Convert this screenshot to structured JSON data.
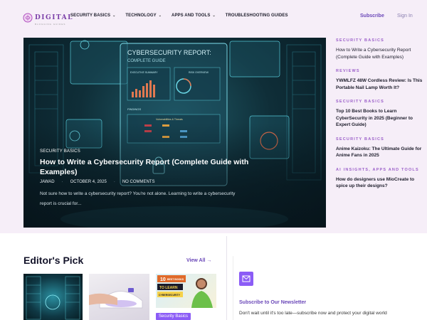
{
  "brand": {
    "name": "DIGITAL",
    "tagline": "BLOGGING GUIDES",
    "accent": "#7b3fa8"
  },
  "nav": {
    "items": [
      {
        "label": "SECURITY BASICS",
        "has_dropdown": true
      },
      {
        "label": "TECHNOLOGY",
        "has_dropdown": true
      },
      {
        "label": "APPS AND TOOLS",
        "has_dropdown": true
      },
      {
        "label": "TROUBLESHOOTING GUIDES",
        "has_dropdown": false
      }
    ],
    "subscribe": "Subscribe",
    "signin": "Sign In"
  },
  "hero": {
    "category": "SECURITY BASICS",
    "title": "How to Write a Cybersecurity Report (Complete Guide with Examples)",
    "author": "JAWAD",
    "date": "OCTOBER 4, 2025",
    "comments": "NO COMMENTS",
    "excerpt": "Not sure how to write a cybersecurity report? You're not alone. Learning to write a cybersecurity report is crucial for...",
    "image_text": {
      "heading": "CYBERSECURITY REPORT:",
      "subheading": "COMPLETE GUIDE",
      "panel_a": "EXECUTIVE SUMMARY",
      "panel_b": "RISK OVERVIEW",
      "panel_c": "FINDINGS",
      "panel_d": "Vulnerabilities & Threats"
    }
  },
  "sidebar": {
    "items": [
      {
        "category": "SECURITY BASICS",
        "title": "How to Write a Cybersecurity Report (Complete Guide with Examples)",
        "bold": false
      },
      {
        "category": "REVIEWS",
        "title": "YWMLFZ 48W Cordless Review: Is This Portable Nail Lamp Worth It?",
        "bold": true
      },
      {
        "category": "SECURITY BASICS",
        "title": "Top 10 Best Books to Learn CyberSecurity in 2025 (Beginner to Expert Guide)",
        "bold": true
      },
      {
        "category": "SECURITY BASICS",
        "title": "Anime Kaizoku: The Ultimate Guide for Anime Fans in 2025",
        "bold": true
      },
      {
        "category": "AI INSIGHTS, APPS AND TOOLS",
        "title": "How do designers use MioCreate to spice up their designs?",
        "bold": true
      }
    ]
  },
  "editors_pick": {
    "heading": "Editor's Pick",
    "view_all": "View All →",
    "badge": "Security Basics",
    "thumb3_text": {
      "num": "10",
      "line1": "BEST BOOKS",
      "line2": "TO LEARN",
      "line3": "CYBERSECURITY"
    }
  },
  "newsletter": {
    "title": "Subscribe to Our Newsletter",
    "text": "Don't wait until it's too late—subscribe now and protect your digital world"
  }
}
